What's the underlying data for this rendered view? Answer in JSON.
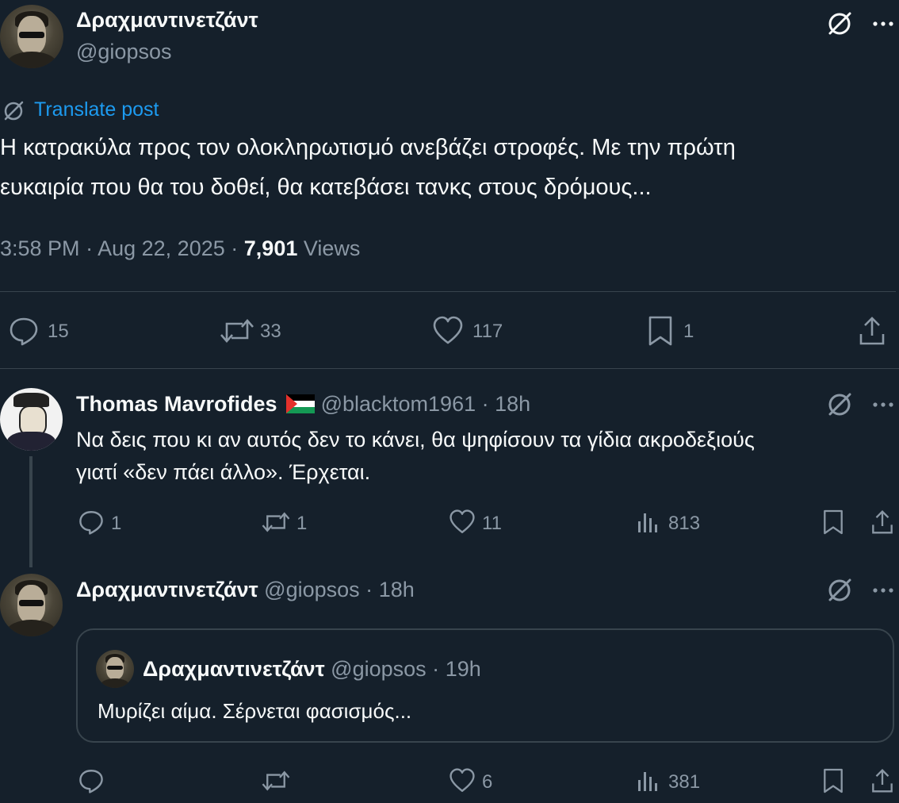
{
  "main_post": {
    "author_name": "Δραχμαντινετζάντ",
    "author_handle": "@giopsos",
    "translate_label": "Translate post",
    "text_line1": "Η κατρακύλα προς τον ολοκληρωτισμό ανεβάζει στροφές. Με την πρώτη",
    "text_line2": "ευκαιρία που θα του δοθεί, θα κατεβάσει τανκς στους δρόμους...",
    "time": "3:58 PM",
    "sep1": "·",
    "date": "Aug 22, 2025",
    "sep2": "·",
    "views_count": "7,901",
    "views_label": "Views",
    "stats": {
      "replies": "15",
      "reposts": "33",
      "likes": "117",
      "bookmarks": "1"
    }
  },
  "reply1": {
    "author_name": "Thomas Mavrofides",
    "author_handle": "@blacktom1961",
    "sep": "·",
    "time": "18h",
    "text_line1": "Να δεις που κι αν αυτός δεν το κάνει, θα ψηφίσουν τα γίδια ακροδεξιούς",
    "text_line2": "γιατί «δεν πάει άλλο». Έρχεται.",
    "stats": {
      "replies": "1",
      "reposts": "1",
      "likes": "11",
      "views": "813"
    }
  },
  "reply2": {
    "author_name": "Δραχμαντινετζάντ",
    "author_handle": "@giopsos",
    "sep": "·",
    "time": "18h",
    "quote": {
      "author_name": "Δραχμαντινετζάντ",
      "author_handle": "@giopsos",
      "sep": "·",
      "time": "19h",
      "text": "Μυρίζει αίμα. Σέρνεται φασισμός..."
    },
    "stats": {
      "likes": "6",
      "views": "381"
    }
  },
  "icons": {
    "grok": "grok-icon",
    "more": "more-icon",
    "reply": "reply-icon",
    "repost": "repost-icon",
    "like": "like-icon",
    "bookmark": "bookmark-icon",
    "share": "share-icon",
    "views": "views-icon",
    "translate": "translate-icon",
    "flag": "palestine-flag-icon"
  },
  "colors": {
    "background": "#15202b",
    "text": "#f7f9f9",
    "muted": "#8b98a5",
    "link": "#1d9bf0",
    "border": "#38444d"
  }
}
